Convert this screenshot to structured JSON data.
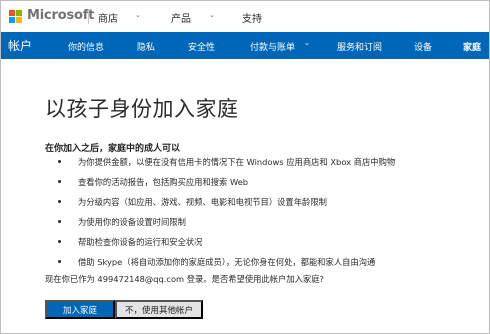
{
  "header": {
    "brand": "Microsoft",
    "nav": [
      "商店",
      "产品",
      "支持"
    ]
  },
  "account_nav": {
    "account_label": "帐户",
    "items": [
      "你的信息",
      "隐私",
      "安全性",
      "付款与账单",
      "服务和订阅",
      "设备",
      "家庭"
    ],
    "selected": "家庭"
  },
  "main": {
    "title": "以孩子身份加入家庭",
    "subhead": "在你加入之后，家庭中的成人可以",
    "bullets": [
      "为你提供金额，以便在没有信用卡的情况下在 Windows 应用商店和 Xbox 商店中购物",
      "查看你的活动报告，包括购买应用和搜索 Web",
      "为分级内容（如应用、游戏、视频、电影和电视节目）设置年龄限制",
      "为使用你的设备设置时间限制",
      "帮助检查你设备的运行和安全状况",
      "借助 Skype（将自动添加你的家庭成员），无论你身在何处，都能和家人自由沟通"
    ],
    "question": "现在你已作为 499472148@qq.com 登录。是否希望使用此帐户加入家庭?",
    "join_button": "加入家庭",
    "other_account_button": "不，使用其他帐户"
  },
  "colors": {
    "accent": "#0067b8",
    "secondary_button": "#e3e3e3"
  }
}
